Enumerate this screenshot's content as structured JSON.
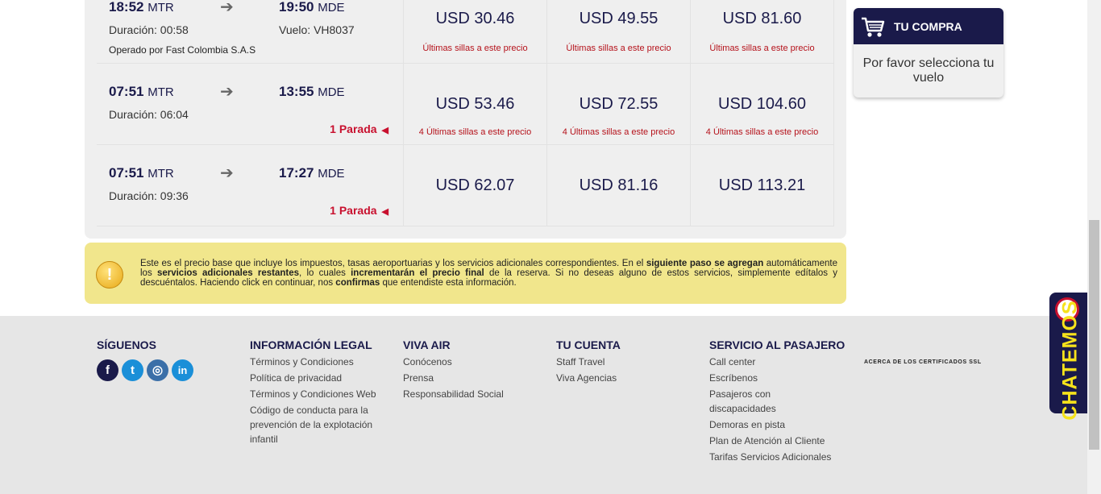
{
  "flights": [
    {
      "depart_time": "18:52",
      "depart_code": "MTR",
      "arrive_time": "19:50",
      "arrive_code": "MDE",
      "duration": "Duración: 00:58",
      "flight_no": "Vuelo: VH8037",
      "operated_by": "Operado por Fast Colombia S.A.S",
      "stops": "",
      "prices": [
        {
          "price": "USD 30.46",
          "note": "Últimas sillas a este precio"
        },
        {
          "price": "USD 49.55",
          "note": "Últimas sillas a este precio"
        },
        {
          "price": "USD 81.60",
          "note": "Últimas sillas a este precio"
        }
      ]
    },
    {
      "depart_time": "07:51",
      "depart_code": "MTR",
      "arrive_time": "13:55",
      "arrive_code": "MDE",
      "duration": "Duración: 06:04",
      "flight_no": "",
      "operated_by": "",
      "stops": "1 Parada",
      "prices": [
        {
          "price": "USD 53.46",
          "note": "4 Últimas sillas a este precio"
        },
        {
          "price": "USD 72.55",
          "note": "4 Últimas sillas a este precio"
        },
        {
          "price": "USD 104.60",
          "note": "4 Últimas sillas a este precio"
        }
      ]
    },
    {
      "depart_time": "07:51",
      "depart_code": "MTR",
      "arrive_time": "17:27",
      "arrive_code": "MDE",
      "duration": "Duración: 09:36",
      "flight_no": "",
      "operated_by": "",
      "stops": "1 Parada",
      "prices": [
        {
          "price": "USD 62.07",
          "note": ""
        },
        {
          "price": "USD 81.16",
          "note": ""
        },
        {
          "price": "USD 113.21",
          "note": ""
        }
      ]
    }
  ],
  "notice": {
    "t1": "Este es el precio base que incluye los impuestos, tasas aeroportuarias y los servicios adicionales correspondientes. En el ",
    "b1": "siguiente paso se agregan",
    "t2": " automáticamente los ",
    "b2": "servicios adicionales restantes",
    "t3": ", lo cuales ",
    "b3": "incrementarán el precio final",
    "t4": " de la reserva. Si no deseas alguno de estos servicios, simplemente edítalos y descuéntalos. Haciendo click en continuar, nos ",
    "b4": "confirmas",
    "t5": " que entendiste esta información."
  },
  "cart": {
    "title": "TU COMPRA",
    "message": "Por favor selecciona tu vuelo",
    "icon": "shopping-cart-icon"
  },
  "footer": {
    "social_title": "SÍGUENOS",
    "social": [
      "facebook-icon",
      "twitter-icon",
      "instagram-icon",
      "linkedin-icon"
    ],
    "legal": {
      "title": "INFORMACIÓN LEGAL",
      "links": [
        "Términos y Condiciones",
        "Política de privacidad",
        "Términos y Condiciones Web",
        "Código de conducta para la prevención de la explotación infantil"
      ]
    },
    "viva": {
      "title": "VIVA AIR",
      "links": [
        "Conócenos",
        "Prensa",
        "Responsabilidad Social"
      ]
    },
    "account": {
      "title": "TU CUENTA",
      "links": [
        "Staff Travel",
        "Viva Agencias"
      ]
    },
    "service": {
      "title": "SERVICIO AL PASAJERO",
      "links": [
        "Call center",
        "Escríbenos",
        "Pasajeros con discapacidades",
        "Demoras en pista",
        "Plan de Atención al Cliente",
        "Tarifas Servicios Adicionales"
      ]
    },
    "ssl": "ACERCA DE LOS CERTIFICADOS SSL"
  },
  "chat": {
    "label": "CHATEMOS"
  },
  "colors": {
    "navy": "#1a1a4a",
    "red": "#c8102e",
    "notice": "#f1e68c",
    "footer": "#e6e6e6"
  }
}
